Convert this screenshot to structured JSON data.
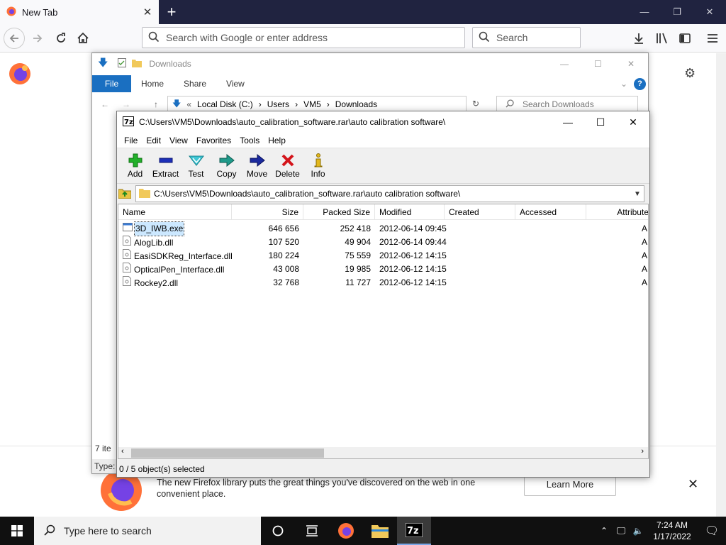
{
  "firefox": {
    "tab_title": "New Tab",
    "url_placeholder": "Search with Google or enter address",
    "search_placeholder": "Search",
    "banner_text": "The new Firefox library puts the great things you've discovered on the web in one convenient place.",
    "learn_more": "Learn More"
  },
  "explorer": {
    "title": "Downloads",
    "ribbon": [
      "File",
      "Home",
      "Share",
      "View"
    ],
    "breadcrumb": [
      "Local Disk (C:)",
      "Users",
      "VM5",
      "Downloads"
    ],
    "search_placeholder": "Search Downloads",
    "status": "7 ite",
    "type_col": "Type:"
  },
  "zip": {
    "title": "C:\\Users\\VM5\\Downloads\\auto_calibration_software.rar\\auto calibration software\\",
    "menu": [
      "File",
      "Edit",
      "View",
      "Favorites",
      "Tools",
      "Help"
    ],
    "toolbar": [
      "Add",
      "Extract",
      "Test",
      "Copy",
      "Move",
      "Delete",
      "Info"
    ],
    "path": "C:\\Users\\VM5\\Downloads\\auto_calibration_software.rar\\auto calibration software\\",
    "columns": [
      "Name",
      "Size",
      "Packed Size",
      "Modified",
      "Created",
      "Accessed",
      "Attributes"
    ],
    "rows": [
      {
        "name": "3D_IWB.exe",
        "size": "646 656",
        "packed": "252 418",
        "modified": "2012-06-14 09:45"
      },
      {
        "name": "AlogLib.dll",
        "size": "107 520",
        "packed": "49 904",
        "modified": "2012-06-14 09:44"
      },
      {
        "name": "EasiSDKReg_Interface.dll",
        "size": "180 224",
        "packed": "75 559",
        "modified": "2012-06-12 14:15"
      },
      {
        "name": "OpticalPen_Interface.dll",
        "size": "43 008",
        "packed": "19 985",
        "modified": "2012-06-12 14:15"
      },
      {
        "name": "Rockey2.dll",
        "size": "32 768",
        "packed": "11 727",
        "modified": "2012-06-12 14:15"
      }
    ],
    "attr_char": "A",
    "status": "0 / 5 object(s) selected"
  },
  "taskbar": {
    "search_placeholder": "Type here to search",
    "time": "7:24 AM",
    "date": "1/17/2022"
  },
  "colors": {
    "firefox_tabbar": "#202340",
    "explorer_file_tab": "#1a6fc1",
    "selection": "#cce8ff",
    "taskbar": "#101010"
  }
}
